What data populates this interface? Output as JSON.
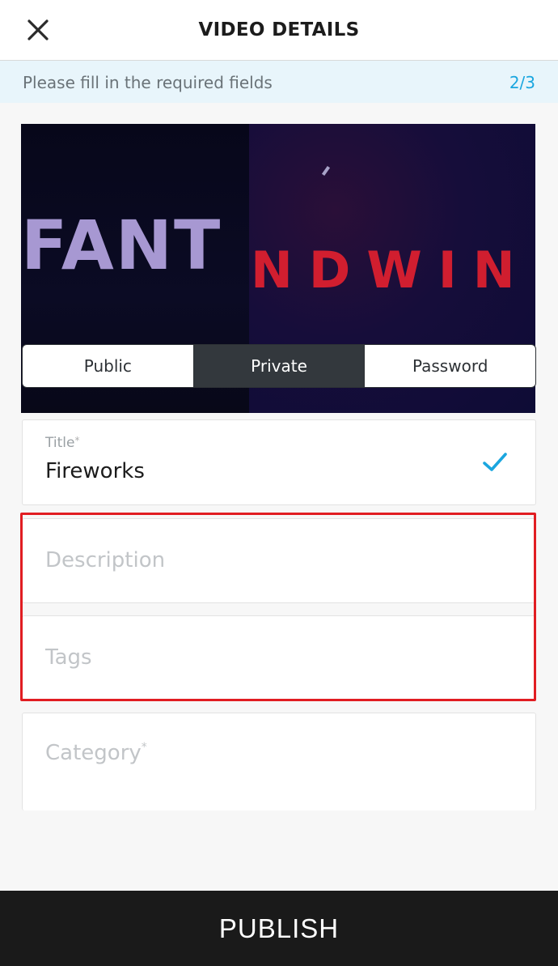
{
  "header": {
    "title": "VIDEO DETAILS",
    "close_icon": "close-icon"
  },
  "notice": {
    "text": "Please fill in the required fields",
    "step": "2/3",
    "step_color": "#1aa6df"
  },
  "thumbnail": {
    "text_left": "FANT",
    "text_right": "NDWIN"
  },
  "privacy": {
    "options": [
      "Public",
      "Private",
      "Password"
    ],
    "selected": "Private"
  },
  "fields": {
    "title": {
      "label": "Title",
      "required_mark": "*",
      "value": "Fireworks",
      "valid_icon": "checkmark-icon",
      "check_color": "#1aa6df"
    },
    "description": {
      "placeholder": "Description"
    },
    "tags": {
      "placeholder": "Tags"
    },
    "category": {
      "placeholder": "Category",
      "required_mark": "*"
    }
  },
  "highlight_color": "#e11d22",
  "footer": {
    "publish_label": "PUBLISH"
  }
}
